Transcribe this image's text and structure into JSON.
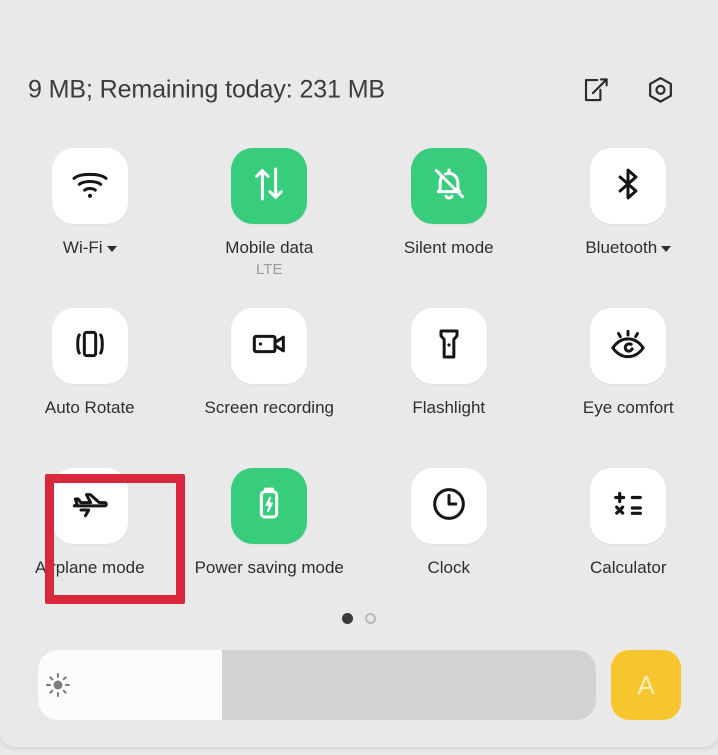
{
  "panel": {
    "background_color": "#e9e9e9",
    "active_tile_color": "#38cc7d",
    "inactive_tile_color": "#ffffff",
    "highlight_color": "#d9283c"
  },
  "header": {
    "data_usage_text": "9 MB; Remaining today: 231 MB",
    "edit_icon": "edit-square-icon",
    "settings_icon": "settings-hexagon-icon"
  },
  "tiles": [
    [
      {
        "label": "Wi-Fi",
        "icon": "wifi-icon",
        "active": false,
        "has_caret": true,
        "sublabel": ""
      },
      {
        "label": "Mobile data",
        "icon": "data-transfer-arrows-icon",
        "active": true,
        "has_caret": false,
        "sublabel": "LTE"
      },
      {
        "label": "Silent mode",
        "icon": "bell-slash-icon",
        "active": true,
        "has_caret": false,
        "sublabel": ""
      },
      {
        "label": "Bluetooth",
        "icon": "bluetooth-icon",
        "active": false,
        "has_caret": true,
        "sublabel": ""
      }
    ],
    [
      {
        "label": "Auto Rotate",
        "icon": "auto-rotate-icon",
        "active": false,
        "has_caret": false,
        "sublabel": ""
      },
      {
        "label": "Screen recording",
        "icon": "video-camera-icon",
        "active": false,
        "has_caret": false,
        "sublabel": ""
      },
      {
        "label": "Flashlight",
        "icon": "flashlight-icon",
        "active": false,
        "has_caret": false,
        "sublabel": ""
      },
      {
        "label": "Eye comfort",
        "icon": "eye-icon",
        "active": false,
        "has_caret": false,
        "sublabel": ""
      }
    ],
    [
      {
        "label": "Airplane mode",
        "icon": "airplane-icon",
        "active": false,
        "has_caret": false,
        "sublabel": ""
      },
      {
        "label": "Power saving mode",
        "icon": "battery-bolt-icon",
        "active": true,
        "has_caret": false,
        "sublabel": ""
      },
      {
        "label": "Clock",
        "icon": "clock-icon",
        "active": false,
        "has_caret": false,
        "sublabel": ""
      },
      {
        "label": "Calculator",
        "icon": "calculator-icon",
        "active": false,
        "has_caret": false,
        "sublabel": ""
      }
    ]
  ],
  "page_dots": {
    "count": 2,
    "active_index": 0
  },
  "brightness": {
    "icon": "sun-brightness-icon",
    "fill_percent": 33,
    "auto_button_label": "A",
    "auto_button_color": "#f7c62e"
  }
}
